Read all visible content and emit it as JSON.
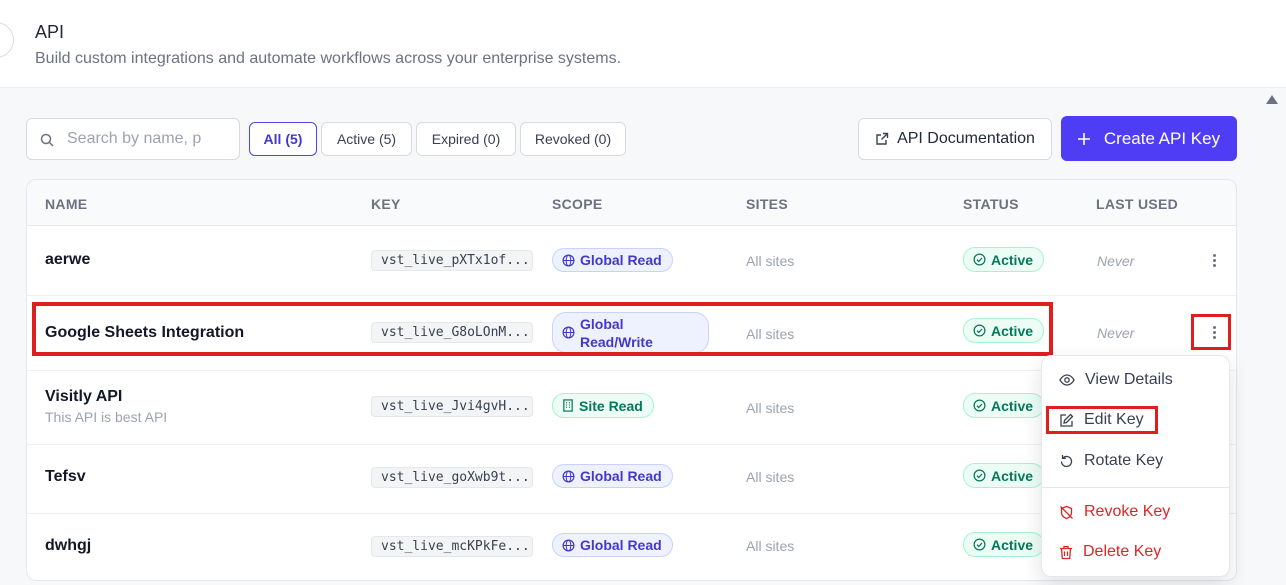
{
  "header": {
    "title": "API",
    "subtitle": "Build custom integrations and automate workflows across your enterprise systems."
  },
  "toolbar": {
    "search_placeholder": "Search by name, p",
    "filters": [
      {
        "label": "All (5)",
        "active": true
      },
      {
        "label": "Active (5)",
        "active": false
      },
      {
        "label": "Expired (0)",
        "active": false
      },
      {
        "label": "Revoked (0)",
        "active": false
      }
    ],
    "docs_label": "API Documentation",
    "create_label": "Create API Key"
  },
  "table": {
    "columns": [
      "NAME",
      "KEY",
      "SCOPE",
      "SITES",
      "STATUS",
      "LAST USED"
    ],
    "rows": [
      {
        "name": "aerwe",
        "description": "",
        "key": "vst_live_pXTx1of...",
        "scope": "Global Read",
        "scope_icon": "globe-icon",
        "sites": "All sites",
        "status": "Active",
        "last_used": "Never"
      },
      {
        "name": "Google Sheets Integration",
        "description": "",
        "key": "vst_live_G8oLOnM...",
        "scope_line1": "Global",
        "scope_line2": "Read/Write",
        "scope_icon": "globe-icon",
        "sites": "All sites",
        "status": "Active",
        "last_used": "Never"
      },
      {
        "name": "Visitly API",
        "description": "This API is best API",
        "key": "vst_live_Jvi4gvH...",
        "scope": "Site Read",
        "scope_icon": "building-icon",
        "sites": "All sites",
        "status": "Active",
        "last_used": ""
      },
      {
        "name": "Tefsv",
        "description": "",
        "key": "vst_live_goXwb9t...",
        "scope": "Global Read",
        "scope_icon": "globe-icon",
        "sites": "All sites",
        "status": "Active",
        "last_used": ""
      },
      {
        "name": "dwhgj",
        "description": "",
        "key": "vst_live_mcKPkFe...",
        "scope": "Global Read",
        "scope_icon": "globe-icon",
        "sites": "All sites",
        "status": "Active",
        "last_used": ""
      }
    ]
  },
  "context_menu": {
    "items": [
      {
        "label": "View Details",
        "icon": "eye-icon",
        "danger": false
      },
      {
        "label": "Edit Key",
        "icon": "edit-icon",
        "danger": false
      },
      {
        "label": "Rotate Key",
        "icon": "rotate-icon",
        "danger": false
      },
      {
        "label": "Revoke Key",
        "icon": "revoke-icon",
        "danger": true
      },
      {
        "label": "Delete Key",
        "icon": "trash-icon",
        "danger": true
      }
    ]
  },
  "colors": {
    "primary": "#4f3cf5",
    "active_green": "#047857",
    "danger": "#dc2626",
    "highlight": "#e01e1e"
  }
}
